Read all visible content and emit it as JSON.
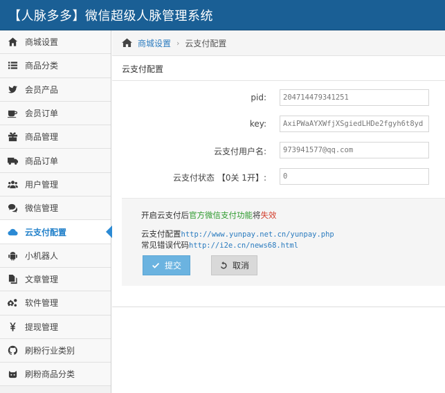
{
  "header": {
    "title": "【人脉多多】微信超级人脉管理系统"
  },
  "sidebar": {
    "items": [
      {
        "label": "商城设置",
        "icon": "home-icon"
      },
      {
        "label": "商品分类",
        "icon": "list-icon"
      },
      {
        "label": "会员产品",
        "icon": "twitter-icon"
      },
      {
        "label": "会员订单",
        "icon": "coffee-icon"
      },
      {
        "label": "商品管理",
        "icon": "gift-icon"
      },
      {
        "label": "商品订单",
        "icon": "truck-icon"
      },
      {
        "label": "用户管理",
        "icon": "users-icon"
      },
      {
        "label": "微信管理",
        "icon": "comments-icon"
      },
      {
        "label": "云支付配置",
        "icon": "cloud-icon",
        "active": true
      },
      {
        "label": "小机器人",
        "icon": "android-icon"
      },
      {
        "label": "文章管理",
        "icon": "files-icon"
      },
      {
        "label": "软件管理",
        "icon": "cogs-icon"
      },
      {
        "label": "提现管理",
        "icon": "yen-icon"
      },
      {
        "label": "刷粉行业类别",
        "icon": "github-icon"
      },
      {
        "label": "刷粉商品分类",
        "icon": "robot-icon"
      }
    ]
  },
  "breadcrumb": {
    "home": "商城设置",
    "sep": "›",
    "current": "云支付配置"
  },
  "panel": {
    "title": "云支付配置"
  },
  "form": {
    "pid": {
      "label": "pid:",
      "value": "204714479341251"
    },
    "key": {
      "label": "key:",
      "value": "AxiPWaAYXWfjXSgiedLHDe2fgyh6t8yd"
    },
    "user": {
      "label": "云支付用户名:",
      "value": "973941577@qq.com"
    },
    "status": {
      "label": "云支付状态 【0关 1开】:",
      "value": "0"
    }
  },
  "notes": {
    "line1_pre": "开启云支付后",
    "line1_green": "官方微信支付功能",
    "line1_mid": "将",
    "line1_red": "失效",
    "line2_label": "云支付配置",
    "line2_link": "http://www.yunpay.net.cn/yunpay.php",
    "line3_label": "常见错误代码",
    "line3_link": "http://i2e.cn/news68.html"
  },
  "buttons": {
    "submit": "提交",
    "cancel": "取消"
  },
  "colors": {
    "header_bg": "#1a5f95",
    "accent": "#2b8ad4",
    "submit_bg": "#6bb3e0",
    "green": "#2f9b2f",
    "red": "#d23c2a"
  }
}
